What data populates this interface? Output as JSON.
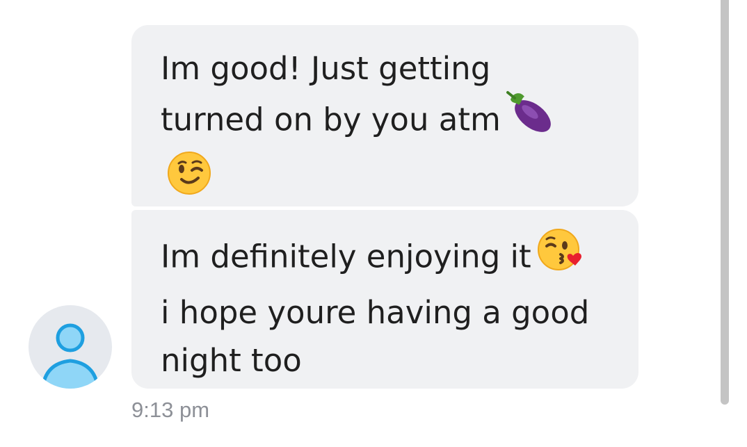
{
  "conversation": {
    "messages": [
      {
        "lines": [
          "Im good! Just getting",
          "turned on by you atm"
        ],
        "emojis": [
          "eggplant-emoji",
          "winking-face-emoji"
        ]
      },
      {
        "lines": [
          "Im definitely enjoying it",
          "i hope youre having a good",
          "night too"
        ],
        "emojis": [
          "face-blowing-kiss-emoji"
        ]
      }
    ],
    "timestamp": "9:13 pm"
  },
  "colors": {
    "bubble_background": "#f0f1f3",
    "text": "#1f1f1f",
    "timestamp": "#8d9097",
    "avatar_background": "#e6e9ee",
    "avatar_figure": "#3cb4f0",
    "scrollbar": "#c4c4c4"
  }
}
